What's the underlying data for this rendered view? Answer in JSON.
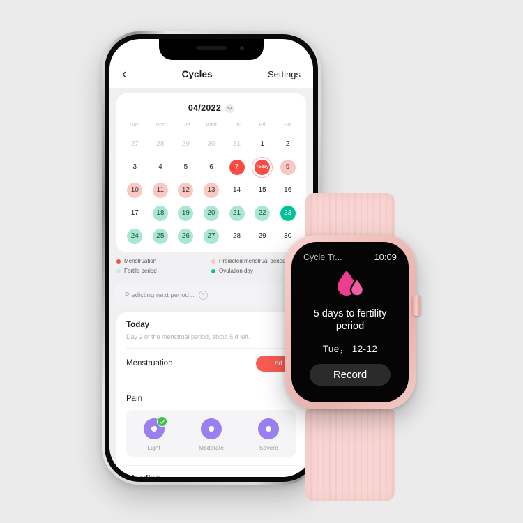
{
  "background_color": "#ebebeb",
  "phone": {
    "nav": {
      "back_icon": "chevron-left-icon",
      "title": "Cycles",
      "settings_label": "Settings"
    },
    "calendar": {
      "month_label": "04/2022",
      "dropdown_icon": "chevron-down-icon",
      "weekdays": [
        "Sun",
        "Mon",
        "Tue",
        "Wed",
        "Thu",
        "Fri",
        "Sat"
      ],
      "days": [
        {
          "label": "27",
          "type": "muted"
        },
        {
          "label": "28",
          "type": "muted"
        },
        {
          "label": "29",
          "type": "muted"
        },
        {
          "label": "30",
          "type": "muted"
        },
        {
          "label": "31",
          "type": "muted"
        },
        {
          "label": "1",
          "type": "plain"
        },
        {
          "label": "2",
          "type": "plain"
        },
        {
          "label": "3",
          "type": "plain"
        },
        {
          "label": "4",
          "type": "plain"
        },
        {
          "label": "5",
          "type": "plain"
        },
        {
          "label": "6",
          "type": "plain"
        },
        {
          "label": "7",
          "type": "mens"
        },
        {
          "label": "Today",
          "type": "today"
        },
        {
          "label": "9",
          "type": "pred"
        },
        {
          "label": "10",
          "type": "pred"
        },
        {
          "label": "11",
          "type": "pred"
        },
        {
          "label": "12",
          "type": "pred"
        },
        {
          "label": "13",
          "type": "pred"
        },
        {
          "label": "14",
          "type": "plain"
        },
        {
          "label": "15",
          "type": "plain"
        },
        {
          "label": "16",
          "type": "plain"
        },
        {
          "label": "17",
          "type": "plain"
        },
        {
          "label": "18",
          "type": "fert"
        },
        {
          "label": "19",
          "type": "fert"
        },
        {
          "label": "20",
          "type": "fert"
        },
        {
          "label": "21",
          "type": "fert"
        },
        {
          "label": "22",
          "type": "fert"
        },
        {
          "label": "23",
          "type": "ovul"
        },
        {
          "label": "24",
          "type": "fert"
        },
        {
          "label": "25",
          "type": "fert"
        },
        {
          "label": "26",
          "type": "fert"
        },
        {
          "label": "27",
          "type": "fert"
        },
        {
          "label": "28",
          "type": "plain"
        },
        {
          "label": "29",
          "type": "plain"
        },
        {
          "label": "30",
          "type": "plain"
        }
      ],
      "legend": [
        {
          "label": "Menstruation",
          "color": "#fa4a42"
        },
        {
          "label": "Predicted menstrual period",
          "color": "#fac7c3"
        },
        {
          "label": "Fertile period",
          "color": "#bfeee0"
        },
        {
          "label": "Ovulation day",
          "color": "#00c39b"
        }
      ],
      "predict_text": "Predicting next period...",
      "help_icon": "question-mark-icon",
      "help_glyph": "?"
    },
    "today_section": {
      "title": "Today",
      "subtitle": "Day 2 of the menstrual period, about 5 d left.",
      "menstruation_label": "Menstruation",
      "end_button": "End",
      "pain_label": "Pain",
      "pain_options": [
        {
          "label": "Light",
          "selected": true
        },
        {
          "label": "Moderate",
          "selected": false
        },
        {
          "label": "Severe",
          "selected": false
        }
      ],
      "bleeding_label": "Bleeding"
    }
  },
  "watch": {
    "app_name": "Cycle Tr...",
    "time": "10:09",
    "drop_icon": "blood-drop-icon",
    "main_text": "5 days to fertility period",
    "date": "Tue， 12-12",
    "record_button": "Record",
    "case_color": "#eebcb7",
    "band_color": "#f8d5d2"
  }
}
